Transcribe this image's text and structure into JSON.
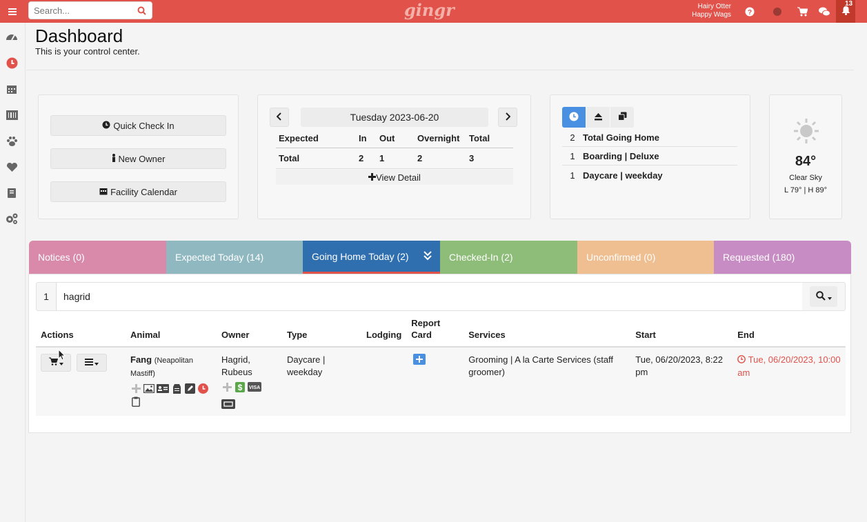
{
  "topbar": {
    "search_placeholder": "Search...",
    "logo": "gingr",
    "account_line1": "Hairy Otter",
    "account_line2": "Happy Wags",
    "notification_count": "13",
    "brand_color": "#e0524a"
  },
  "sidebar": {
    "items": [
      "dashboard-icon",
      "clock-icon",
      "calendar-icon",
      "barcode-icon",
      "paw-icon",
      "heart-icon",
      "book-icon",
      "cogs-icon"
    ]
  },
  "header": {
    "title": "Dashboard",
    "subtitle": "This is your control center."
  },
  "quick_actions": {
    "check_in": "Quick Check In",
    "new_owner": "New Owner",
    "facility_calendar": "Facility Calendar"
  },
  "overview": {
    "date": "Tuesday 2023-06-20",
    "columns": [
      "Expected",
      "In",
      "Out",
      "Overnight",
      "Total"
    ],
    "row": [
      "Total",
      "2",
      "1",
      "2",
      "3"
    ],
    "view_detail": "View Detail"
  },
  "going_home": {
    "rows": [
      {
        "count": "2",
        "label": "Total Going Home"
      },
      {
        "count": "1",
        "label": "Boarding | Deluxe"
      },
      {
        "count": "1",
        "label": "Daycare | weekday"
      }
    ]
  },
  "weather": {
    "temp": "84°",
    "condition": "Clear Sky",
    "range": "L 79° | H 89°"
  },
  "tabs": [
    {
      "label": "Notices (0)",
      "color": "#d98aaa"
    },
    {
      "label": "Expected Today (14)",
      "color": "#8fb8c0"
    },
    {
      "label": "Going Home Today (2)",
      "color": "#2f6fb0"
    },
    {
      "label": "Checked-In (2)",
      "color": "#8ebd7a"
    },
    {
      "label": "Unconfirmed (0)",
      "color": "#efbf91"
    },
    {
      "label": "Requested (180)",
      "color": "#c88cc4"
    }
  ],
  "filter": {
    "count": "1",
    "value": "hagrid"
  },
  "table": {
    "headers": {
      "actions": "Actions",
      "animal": "Animal",
      "owner": "Owner",
      "type": "Type",
      "lodging": "Lodging",
      "report_card_1": "Report",
      "report_card_2": "Card",
      "services": "Services",
      "start": "Start",
      "end": "End"
    },
    "rows": [
      {
        "animal_name": "Fang",
        "animal_breed": "(Neapolitan Mastiff)",
        "owner": "Hagrid, Rubeus",
        "type": "Daycare | weekday",
        "lodging": "",
        "services": "Grooming | A la Carte Services (staff groomer)",
        "start": "Tue, 06/20/2023, 8:22 pm",
        "end": "Tue, 06/20/2023, 10:00 am"
      }
    ]
  }
}
